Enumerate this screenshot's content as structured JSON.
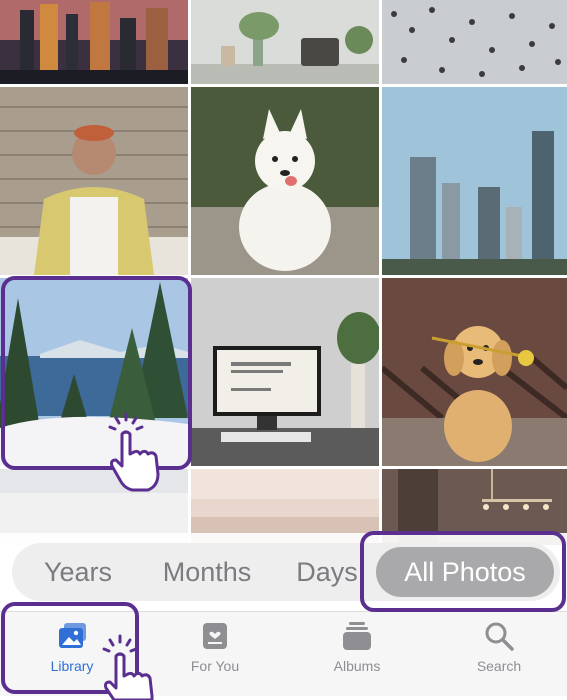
{
  "segments": {
    "years": "Years",
    "months": "Months",
    "days": "Days",
    "all_photos": "All Photos"
  },
  "tabs": {
    "library": "Library",
    "for_you": "For You",
    "albums": "Albums",
    "search": "Search"
  },
  "colors": {
    "accent": "#2f6fd6",
    "highlight": "#5b2f8f",
    "segment_active": "#a9a9ab"
  },
  "icons": {
    "library": "photo-stack-icon",
    "for_you": "for-you-card-icon",
    "albums": "albums-stack-icon",
    "search": "magnifier-icon",
    "pointer": "pointing-hand-icon"
  }
}
